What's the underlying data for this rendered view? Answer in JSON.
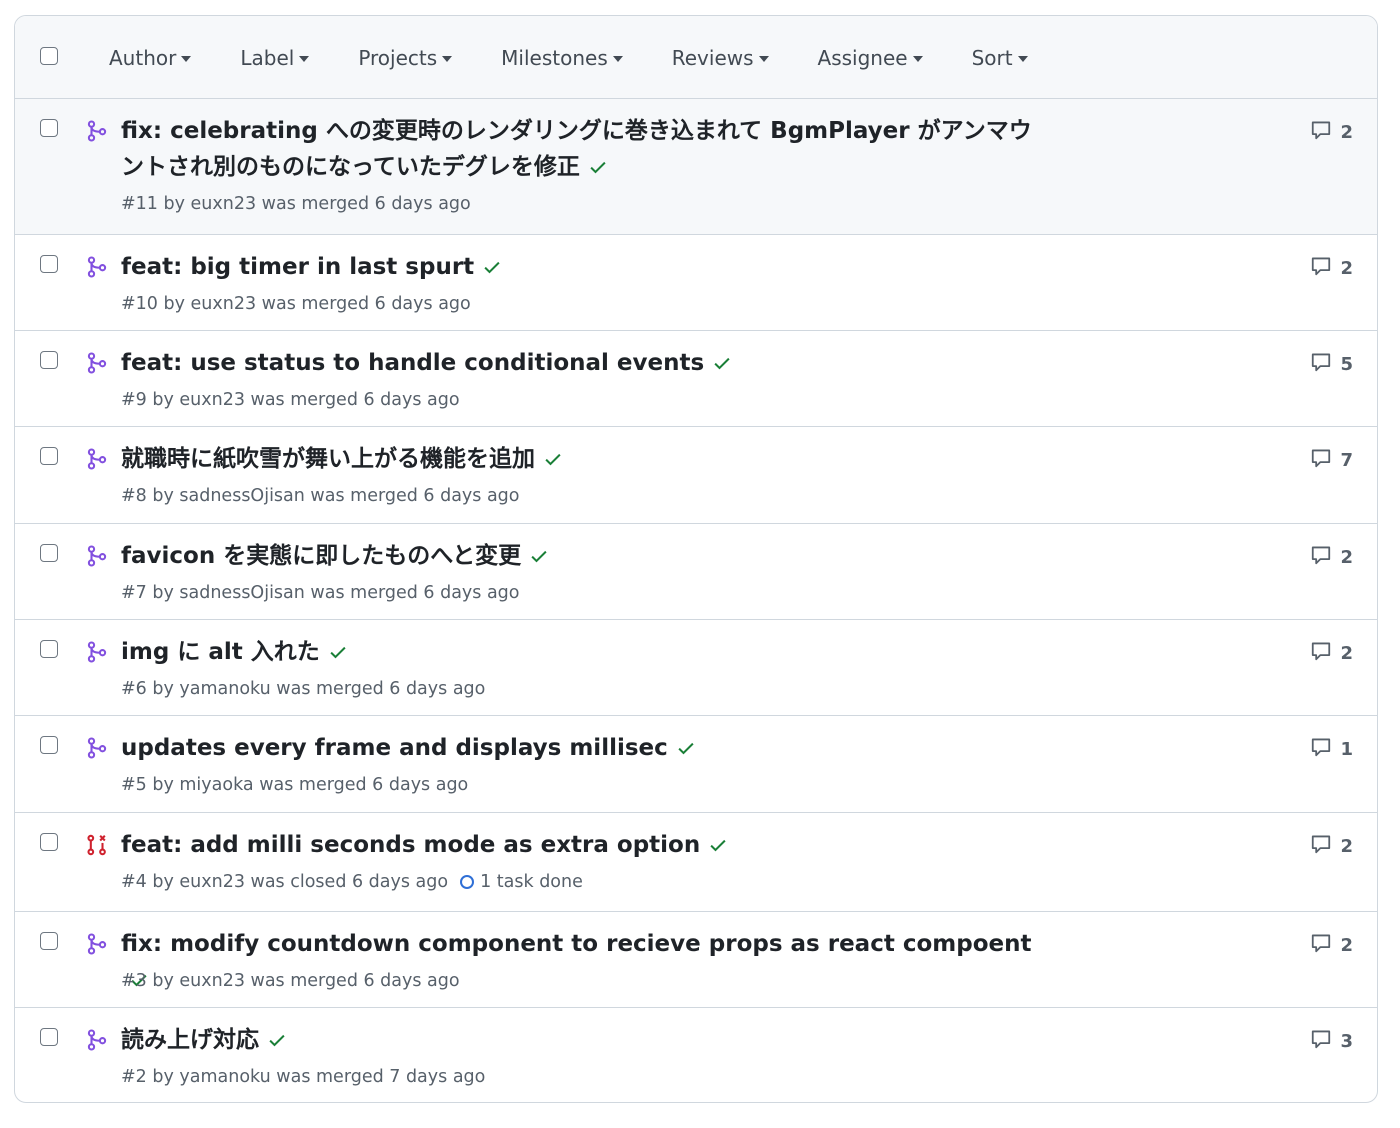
{
  "filters": [
    "Author",
    "Label",
    "Projects",
    "Milestones",
    "Reviews",
    "Assignee",
    "Sort"
  ],
  "colors": {
    "merged": "#8250df",
    "closed": "#cf222e",
    "success": "#1a7f37",
    "task": "#2f6fd6"
  },
  "rows": [
    {
      "title": "fix: celebrating への変更時のレンダリングに巻き込まれて BgmPlayer がアンマウントされ別のものになっていたデグレを修正",
      "meta": "#11 by euxn23 was merged 6 days ago",
      "comments": "2",
      "state_icon": "merged-pr-icon"
    },
    {
      "title": "feat: big timer in last spurt",
      "meta": "#10 by euxn23 was merged 6 days ago",
      "comments": "2",
      "state_icon": "merged-pr-icon"
    },
    {
      "title": "feat: use status to handle conditional events",
      "meta": "#9 by euxn23 was merged 6 days ago",
      "comments": "5",
      "state_icon": "merged-pr-icon"
    },
    {
      "title": "就職時に紙吹雪が舞い上がる機能を追加",
      "meta": "#8 by sadnessOjisan was merged 6 days ago",
      "comments": "7",
      "state_icon": "merged-pr-icon"
    },
    {
      "title": "favicon を実態に即したものへと変更",
      "meta": "#7 by sadnessOjisan was merged 6 days ago",
      "comments": "2",
      "state_icon": "merged-pr-icon"
    },
    {
      "title": "img に alt 入れた",
      "meta": "#6 by yamanoku was merged 6 days ago",
      "comments": "2",
      "state_icon": "merged-pr-icon"
    },
    {
      "title": "updates every frame and displays millisec",
      "meta": "#5 by miyaoka was merged 6 days ago",
      "comments": "1",
      "state_icon": "merged-pr-icon"
    },
    {
      "title": "feat: add milli seconds mode as extra option",
      "meta": "#4 by euxn23 was closed 6 days ago",
      "task": "1 task done",
      "comments": "2",
      "state_icon": "closed-pr-icon"
    },
    {
      "title": "fix: modify countdown component to recieve props as react compoent",
      "meta": "#3 by euxn23 was merged 6 days ago",
      "comments": "2",
      "state_icon": "merged-pr-icon"
    },
    {
      "title": "読み上げ対応",
      "meta": "#2 by yamanoku was merged 7 days ago",
      "comments": "3",
      "state_icon": "merged-pr-icon"
    }
  ]
}
